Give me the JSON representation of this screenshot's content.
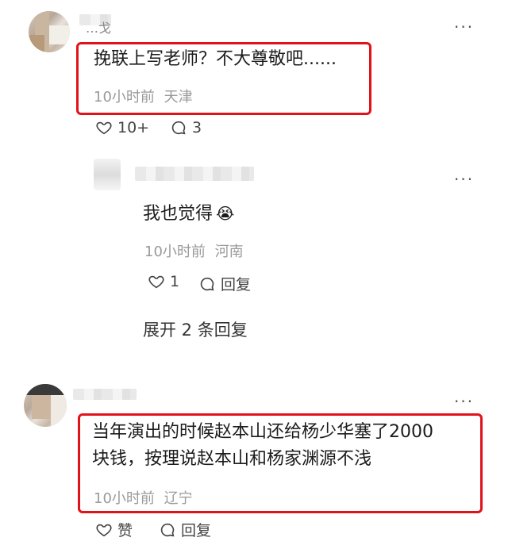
{
  "comments": [
    {
      "username": "…戈",
      "text": "挽联上写老师？不大尊敬吧......",
      "time": "10小时前",
      "location": "天津",
      "likes": "10+",
      "replies": "3",
      "more": "···"
    },
    {
      "text": "我也觉得",
      "emoji": "😭",
      "time": "10小时前",
      "location": "河南",
      "likes": "1",
      "reply_label": "回复",
      "more": "···"
    },
    {
      "line1": "当年演出的时候赵本山还给杨少华塞了2000",
      "line2": "块钱，按理说赵本山和杨家渊源不浅",
      "time": "10小时前",
      "location": "辽宁",
      "like_label": "赞",
      "reply_label": "回复",
      "more": "···"
    }
  ],
  "expand_label": "展开 2 条回复",
  "colors": {
    "highlight": "#e2121b",
    "meta": "#9a9a9a"
  }
}
